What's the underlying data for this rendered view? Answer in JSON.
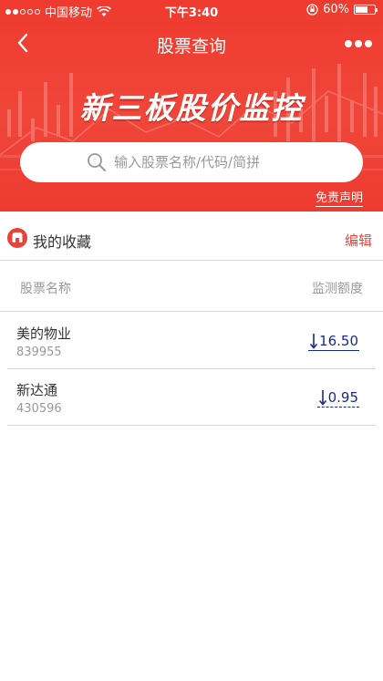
{
  "status_bar": {
    "carrier": "中国移动",
    "time": "下午3:40",
    "battery": "60%",
    "battery_level": 0.6
  },
  "nav": {
    "title": "股票查询"
  },
  "banner": {
    "title": "新三板股价监控"
  },
  "search": {
    "placeholder": "输入股票名称/代码/简拼"
  },
  "disclaimer": "免责声明",
  "favorites": {
    "title": "我的收藏",
    "edit_label": "编辑",
    "columns": {
      "name": "股票名称",
      "quota": "监测额度"
    },
    "items": [
      {
        "name": "美的物业",
        "code": "839955",
        "quota": "16.50"
      },
      {
        "name": "新达通",
        "code": "430596",
        "quota": "0.95"
      }
    ]
  },
  "colors": {
    "brand_red": "#ef3a2f",
    "quota_blue": "#1a2a8a"
  }
}
